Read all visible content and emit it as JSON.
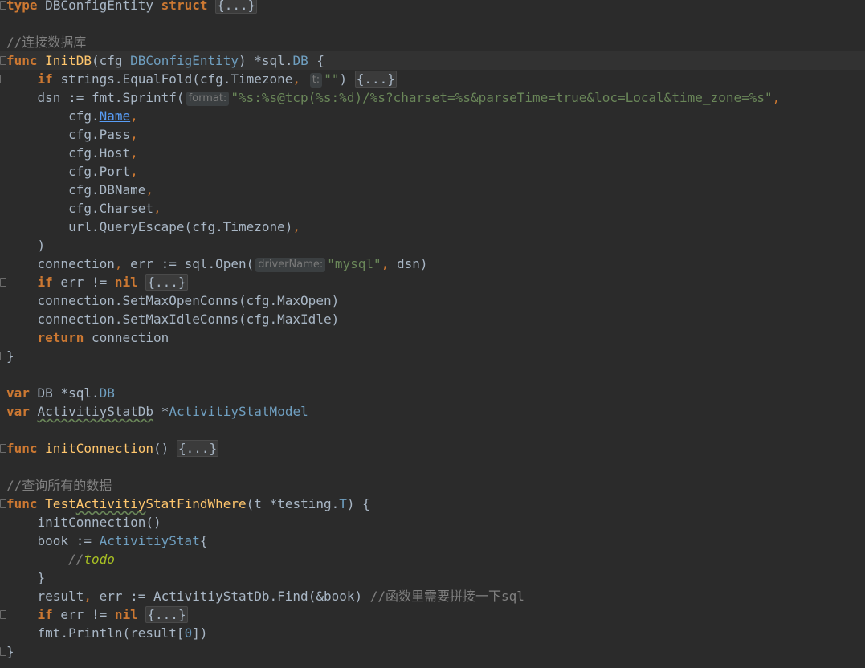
{
  "editor": {
    "language": "Go",
    "theme_colors": {
      "background": "#2b2b2b",
      "keyword": "#cc7832",
      "function": "#ffc66d",
      "type": "#6f9fc0",
      "string": "#6a8759",
      "number": "#6897bb",
      "comment": "#808080",
      "todo": "#a8c023",
      "default": "#a9b7c6"
    }
  },
  "tokens": {
    "kw_type": "type",
    "kw_struct": "struct",
    "kw_func": "func",
    "kw_if": "if",
    "kw_return": "return",
    "kw_var": "var",
    "nil": "nil",
    "ident_DBConfigEntity": "DBConfigEntity",
    "fold_body": "{...}",
    "comment_connect_db": "//连接数据库",
    "fn_InitDB": "InitDB",
    "paren_open": "(",
    "paren_close": ")",
    "param_cfg": "cfg",
    "sig_close_star": ") *",
    "pkg_sql": "sql.",
    "type_DB": "DB",
    "space_brace": " {",
    "brace_close": "}",
    "strings_equalfold": "strings.EqualFold(cfg.Timezone",
    "comma": ",",
    "hint_t": "t:",
    "str_empty": "\"\"",
    "dsn_assign": "dsn := fmt.Sprintf(",
    "hint_format": "format:",
    "str_format": "\"%s:%s@tcp(%s:%d)/%s?charset=%s&parseTime=true&loc=Local&time_zone=%s\"",
    "cfg_dot": "cfg.",
    "field_Name": "Name",
    "field_Pass": "Pass",
    "field_Host": "Host",
    "field_Port": "Port",
    "field_DBName": "DBName",
    "field_Charset": "Charset",
    "url_query_escape": "url.QueryEscape(cfg.Timezone)",
    "connection": "connection",
    "err_assign_open": " err := sql.Open(",
    "hint_driver": "driverName:",
    "str_mysql": "\"mysql\"",
    "dsn_close": " dsn)",
    "err_ne": " err != ",
    "set_max_open": "connection.SetMaxOpenConns(cfg.MaxOpen)",
    "set_max_idle": "connection.SetMaxIdleConns(cfg.MaxIdle)",
    "db_space": "DB *",
    "ident_ActivitiyStatDb": "ActivitiyStatDb",
    "star": "*",
    "type_ActivitiyStatModel": "ActivitiyStatModel",
    "fn_initConnection": "initConnection",
    "empty_parens_space": "() ",
    "comment_query_all": "//查询所有的数据",
    "fn_test_prefix": "Test",
    "fn_test_warn": "Activitiy",
    "fn_test_suffix": "StatFindWhere",
    "t_testing": "t *testing.",
    "type_T": "T",
    "init_connection_call": "initConnection()",
    "book_assign": "book := ",
    "type_ActivitiyStat": "ActivitiyStat",
    "brace_open": "{",
    "comment_slashes": "//",
    "todo_word": "todo",
    "result": "result",
    "find_call": " err := ActivitiyStatDb.Find(&book) ",
    "comment_sql": "//函数里需要拼接一下sql",
    "println_open": "fmt.Println(result[",
    "num_zero": "0",
    "close_bracket_paren": "])"
  }
}
